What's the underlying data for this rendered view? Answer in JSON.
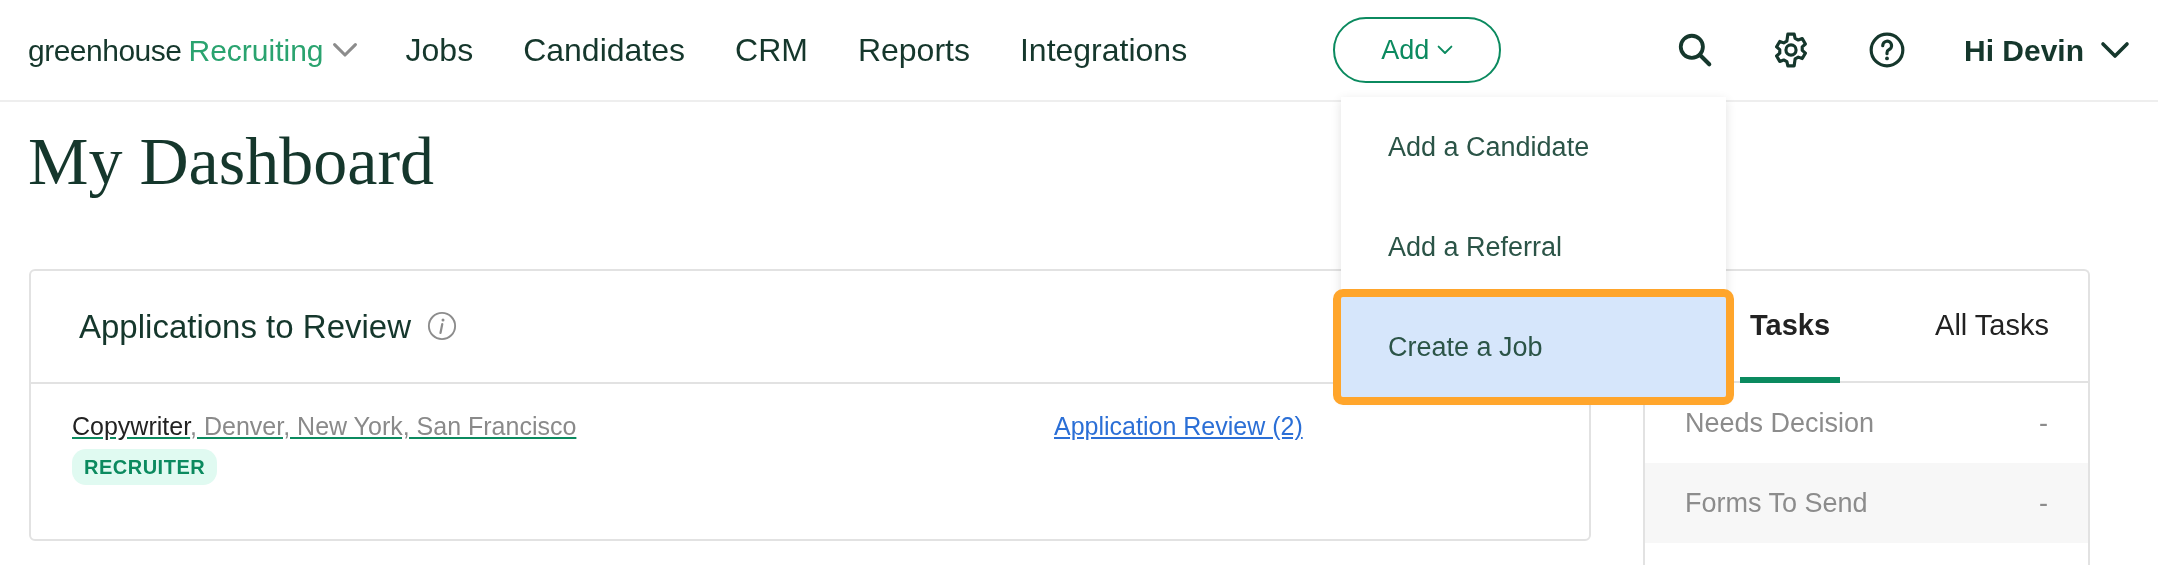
{
  "header": {
    "brand": "greenhouse",
    "product": "Recruiting",
    "nav": [
      {
        "label": "Jobs"
      },
      {
        "label": "Candidates"
      },
      {
        "label": "CRM"
      },
      {
        "label": "Reports"
      },
      {
        "label": "Integrations"
      }
    ],
    "add_button": {
      "label": "Add"
    },
    "user": "Hi Devin"
  },
  "add_menu": {
    "open": true,
    "items": [
      {
        "label": "Add a Candidate",
        "selected": false
      },
      {
        "label": "Add a Referral",
        "selected": false
      },
      {
        "label": "Create a Job",
        "selected": true
      }
    ]
  },
  "page_title": "My Dashboard",
  "applications": {
    "title": "Applications to Review",
    "rows": [
      {
        "job": "Copywriter",
        "locations": ", Denver, New York, San Francisco",
        "tag": "RECRUITER",
        "link": "Application Review (2)"
      }
    ]
  },
  "tasks": {
    "tabs": [
      {
        "label": "Tasks",
        "selected": true
      },
      {
        "label": "All Tasks",
        "selected": false
      }
    ],
    "rows": [
      {
        "label": "Needs Decision",
        "value": "-"
      },
      {
        "label": "Forms To Send",
        "value": "-"
      }
    ]
  }
}
